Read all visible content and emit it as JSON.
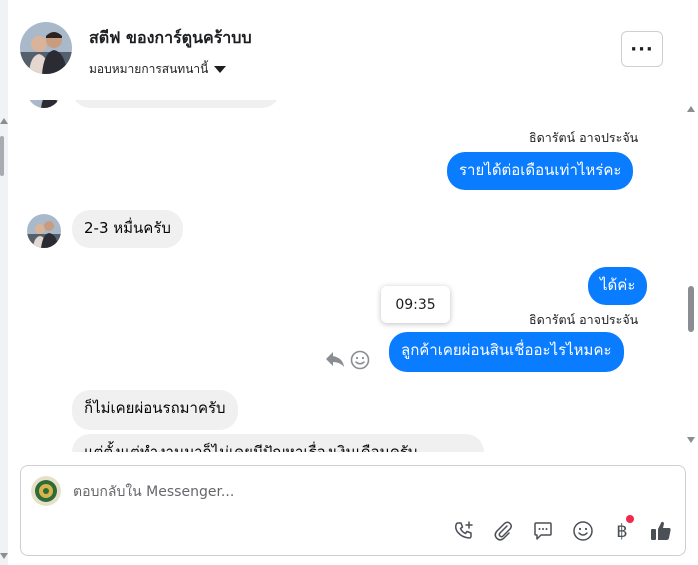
{
  "header": {
    "contact_name": "สตีฟ ของการ์ตูนคร้าบบ",
    "assign_label": "มอบหมายการสนทนานี้",
    "more_label": "···"
  },
  "messages": {
    "m2_sender": "ธิดารัตน์ อาจประจัน",
    "m2_text": "รายได้ต่อเดือนเท่าไหร่คะ",
    "m3_text": "2-3 หมื่นครับ",
    "m4_text": "ได้ค่ะ",
    "tooltip_time": "09:35",
    "m5_sender": "ธิดารัตน์ อาจประจัน",
    "m5_text": "ลูกค้าเคยผ่อนสินเชื่ออะไรไหมคะ",
    "m6_text": "ก็ไม่เคยผ่อนรถมาครับ",
    "m7_text": "แต่ตั้งแต่ทำงานมาก็ไม่เคยมีปัญหาเรื่องเงินเดือนครับ"
  },
  "composer": {
    "placeholder": "ตอบกลับใน Messenger...",
    "tools": [
      "call-add-icon",
      "paperclip-icon",
      "chat-bubble-icon",
      "emoji-icon",
      "baht-icon",
      "like-icon"
    ],
    "baht_symbol": "฿",
    "notification_color": "#f02849"
  },
  "colors": {
    "outgoing_bubble": "#0a7cff",
    "incoming_bubble": "#f0f0f0"
  }
}
